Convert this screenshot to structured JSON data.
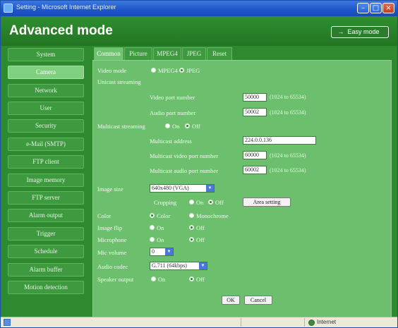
{
  "window": {
    "title": "Setting - Microsoft Internet Explorer"
  },
  "header": {
    "title": "Advanced mode",
    "easy_mode_label": "Easy mode"
  },
  "sidebar": {
    "items": [
      {
        "label": "System"
      },
      {
        "label": "Camera"
      },
      {
        "label": "Network"
      },
      {
        "label": "User"
      },
      {
        "label": "Security"
      },
      {
        "label": "e-Mail (SMTP)"
      },
      {
        "label": "FTP client"
      },
      {
        "label": "Image memory"
      },
      {
        "label": "FTP server"
      },
      {
        "label": "Alarm output"
      },
      {
        "label": "Trigger"
      },
      {
        "label": "Schedule"
      },
      {
        "label": "Alarm buffer"
      },
      {
        "label": "Motion detection"
      }
    ],
    "active": "Camera"
  },
  "tabs": [
    {
      "label": "Common"
    },
    {
      "label": "Picture"
    },
    {
      "label": "MPEG4"
    },
    {
      "label": "JPEG"
    },
    {
      "label": "Reset"
    }
  ],
  "form": {
    "video_mode_label": "Video mode",
    "video_mode_options": [
      "MPEG4",
      "JPEG"
    ],
    "video_mode_selected": "JPEG",
    "unicast_label": "Unicast streaming",
    "video_port_label": "Video port number",
    "video_port_value": "50000",
    "video_port_hint": "(1024 to 65534)",
    "audio_port_label": "Audio port number",
    "audio_port_value": "50002",
    "audio_port_hint": "(1024 to 65534)",
    "multicast_label": "Multicast streaming",
    "multicast_options": [
      "On",
      "Off"
    ],
    "multicast_selected": "Off",
    "multicast_address_label": "Multicast address",
    "multicast_address_value": "224.0.0.136",
    "multicast_video_port_label": "Multicast video port number",
    "multicast_video_port_value": "60000",
    "multicast_video_port_hint": "(1024 to 65534)",
    "multicast_audio_port_label": "Multicast audio port number",
    "multicast_audio_port_value": "60002",
    "multicast_audio_port_hint": "(1024 to 65534)",
    "image_size_label": "Image size",
    "image_size_value": "640x480 (VGA)",
    "cropping_label": "Cropping",
    "cropping_options": [
      "On",
      "Off"
    ],
    "cropping_selected": "Off",
    "area_setting_label": "Area setting",
    "color_label": "Color",
    "color_options": [
      "Color",
      "Monochrome"
    ],
    "color_selected": "Color",
    "image_flip_label": "Image flip",
    "image_flip_options": [
      "On",
      "Off"
    ],
    "image_flip_selected": "Off",
    "microphone_label": "Microphone",
    "microphone_options": [
      "On",
      "Off"
    ],
    "microphone_selected": "Off",
    "mic_volume_label": "Mic volume",
    "mic_volume_value": "0",
    "audio_codec_label": "Audio codec",
    "audio_codec_value": "G.711 (64kbps)",
    "speaker_output_label": "Speaker output",
    "speaker_output_options": [
      "On",
      "Off"
    ],
    "speaker_output_selected": "Off",
    "ok_label": "OK",
    "cancel_label": "Cancel"
  },
  "statusbar": {
    "zone": "Internet"
  }
}
